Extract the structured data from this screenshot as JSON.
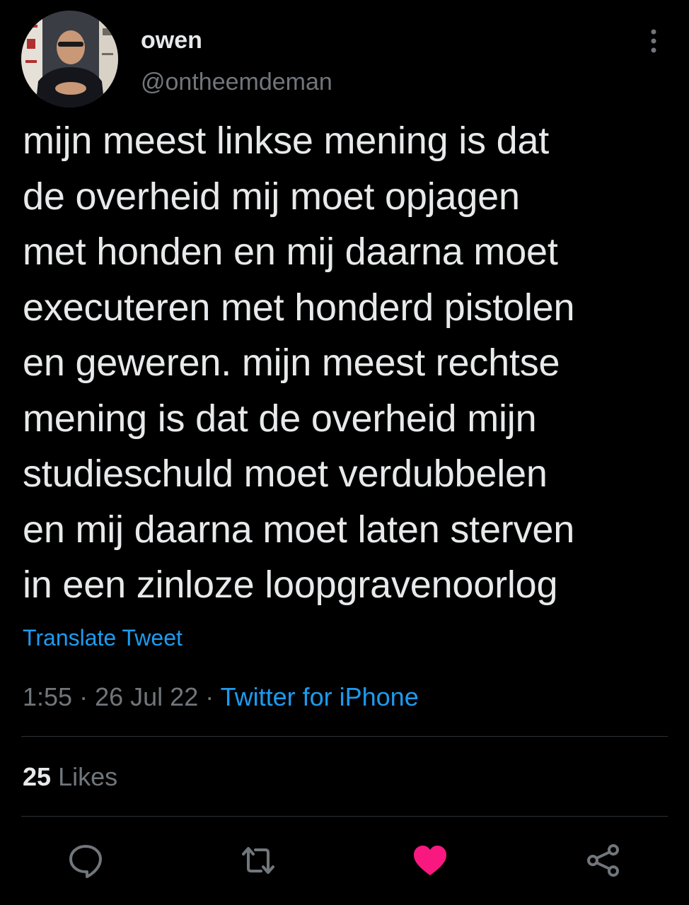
{
  "tweet": {
    "author": {
      "display_name": "owen",
      "handle": "@ontheemdeman",
      "avatar_icon": "profile-photo"
    },
    "text_lines": [
      "mijn meest linkse mening is dat",
      "de overheid mij moet opjagen",
      "met honden en mij daarna moet",
      "executeren met honderd pistolen",
      "en geweren. mijn meest rechtse",
      "mening is dat de overheid mijn",
      "studieschuld moet verdubbelen",
      "en mij daarna moet laten sterven",
      "in een zinloze loopgravenoorlog"
    ],
    "translate_label": "Translate Tweet",
    "time": "1:55",
    "date": "26 Jul 22",
    "separator": "·",
    "source": "Twitter for iPhone",
    "likes_count": "25",
    "likes_label": "Likes",
    "liked": true
  },
  "actions": [
    {
      "name": "reply",
      "icon": "reply-icon"
    },
    {
      "name": "retweet",
      "icon": "retweet-icon"
    },
    {
      "name": "like",
      "icon": "heart-icon"
    },
    {
      "name": "share",
      "icon": "share-icon"
    }
  ],
  "colors": {
    "background": "#000000",
    "text_primary": "#e7e9ea",
    "text_secondary": "#71767b",
    "link": "#1d9bf0",
    "like": "#f91880",
    "divider": "#2f3336"
  }
}
